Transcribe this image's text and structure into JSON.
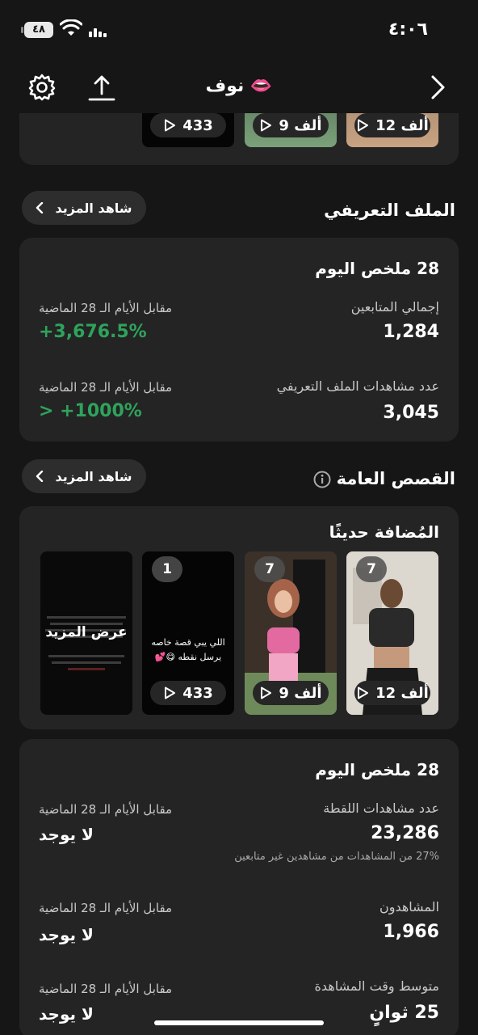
{
  "status": {
    "time": "٤:٠٦",
    "battery": "٤٨"
  },
  "nav": {
    "title": "نوف 👄"
  },
  "top_strip": {
    "views": [
      "433",
      "9 ألف",
      "12 ألف"
    ]
  },
  "profile": {
    "heading": "الملف التعريفي",
    "see_more": "شاهد المزيد",
    "summary_title": "28 ملخص اليوم",
    "followers_label": "إجمالي المتابعين",
    "followers_value": "1,284",
    "followers_compare_label": "مقابل الأيام الـ 28 الماضية",
    "followers_change": "+3,676.5%",
    "views_label": "عدد مشاهدات الملف التعريفي",
    "views_value": "3,045",
    "views_compare_label": "مقابل الأيام الـ 28 الماضية",
    "views_change": "> +1000%"
  },
  "stories": {
    "heading": "القصص العامة",
    "see_more": "شاهد المزيد",
    "recent_title": "المُضافة حديثًا",
    "items": [
      {
        "badge": "7",
        "views": "12 ألف"
      },
      {
        "badge": "7",
        "views": "9 ألف"
      },
      {
        "badge": "1",
        "views": "433",
        "caption": "اللي يبي قصة خاصه يرسل نقطه 😋💕"
      },
      {
        "more_label": "عرض المزيد"
      }
    ]
  },
  "story_summary": {
    "title": "28 ملخص اليوم",
    "snap_views_label": "عدد مشاهدات اللقطة",
    "snap_views_value": "23,286",
    "snap_views_note": "27% من المشاهدات من مشاهدين غير متابعين",
    "viewers_label": "المشاهدون",
    "viewers_value": "1,966",
    "watch_label": "متوسط وقت المشاهدة",
    "watch_value": "25 ثوانٍ",
    "compare_label": "مقابل الأيام الـ 28 الماضية",
    "none_value": "لا يوجد"
  },
  "colors": {
    "positive": "#2ea35b",
    "card": "#242424",
    "background": "#161616"
  }
}
